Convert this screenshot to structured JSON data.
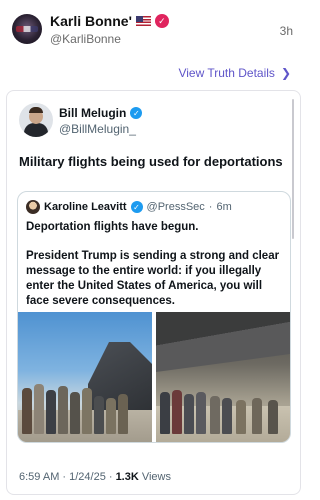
{
  "post": {
    "author_name": "Karli Bonne'",
    "author_handle": "@KarliBonne",
    "time_ago": "3h",
    "view_details_label": "View Truth Details"
  },
  "embedded_tweet": {
    "author_name": "Bill Melugin",
    "author_handle": "@BillMelugin_",
    "text": "Military flights being used for deportations",
    "quote": {
      "author_name": "Karoline Leavitt",
      "author_handle": "@PressSec",
      "age": "6m",
      "line1": "Deportation flights have begun.",
      "line2": "President Trump is sending a strong and clear message to the entire world: if you illegally enter the United States of America, you will face severe consequences."
    },
    "timestamp": "6:59 AM · 1/24/25 ·",
    "views_count": "1.3K",
    "views_label": "Views"
  },
  "colors": {
    "accent_link": "#5f55c9",
    "verified_red": "#e0245e",
    "verified_blue": "#1d9bf0"
  },
  "icons": [
    "us-flag-icon",
    "red-verified-icon",
    "blue-verified-icon",
    "chevron-right-icon"
  ]
}
